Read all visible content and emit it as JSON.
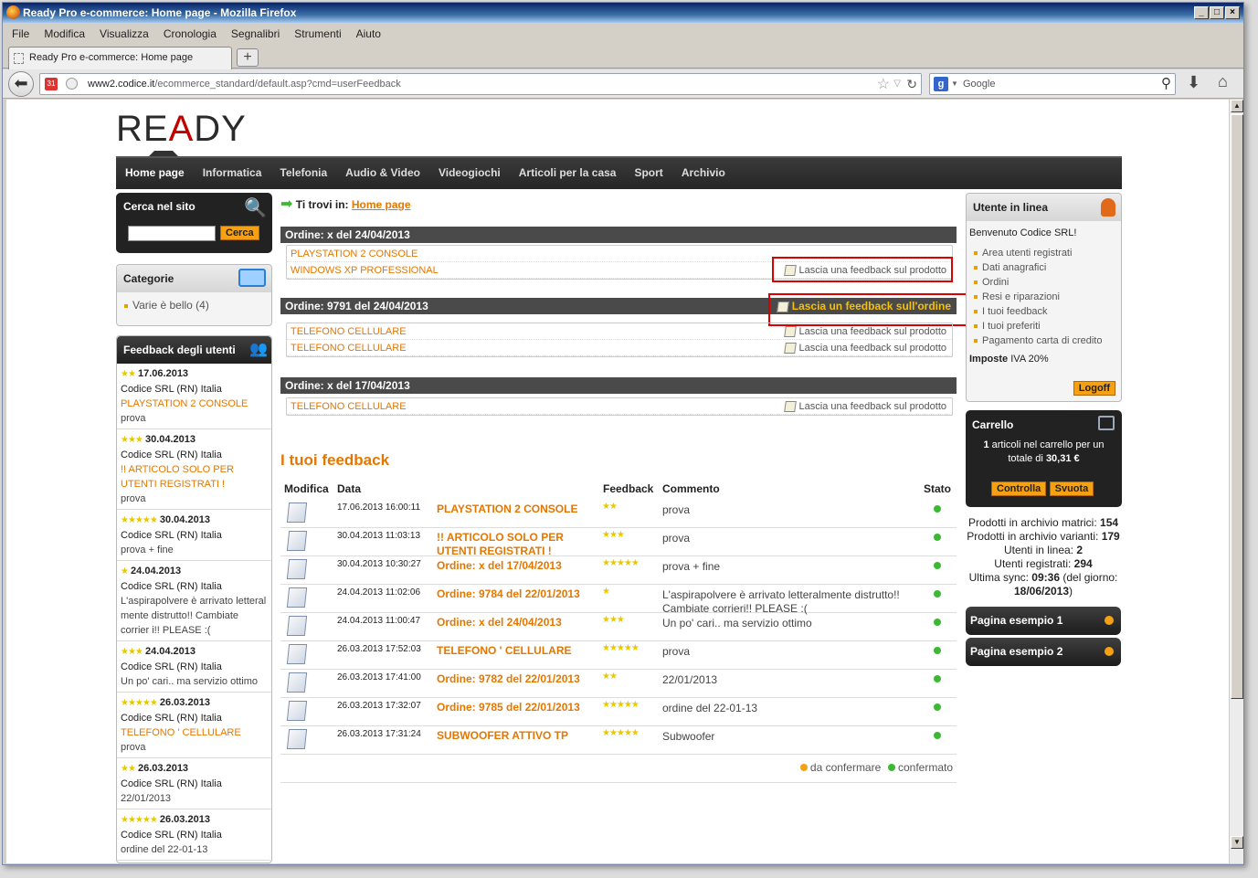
{
  "window": {
    "title": "Ready Pro e-commerce: Home page - Mozilla Firefox"
  },
  "menu": [
    "File",
    "Modifica",
    "Visualizza",
    "Cronologia",
    "Segnalibri",
    "Strumenti",
    "Aiuto"
  ],
  "tab": {
    "label": "Ready Pro e-commerce: Home page",
    "new_tab": "+"
  },
  "url": {
    "host": "www2.codice.it",
    "path": "/ecommerce_standard/default.asp?cmd=userFeedback"
  },
  "search": {
    "engine": "Google"
  },
  "site": {
    "logo": "READY",
    "nav": [
      "Home page",
      "Informatica",
      "Telefonia",
      "Audio & Video",
      "Videogiochi",
      "Articoli per la casa",
      "Sport",
      "Archivio"
    ],
    "breadcrumb": {
      "prefix": "Ti trovi in:",
      "link": "Home page"
    },
    "search_box": {
      "title": "Cerca nel sito",
      "button": "Cerca"
    },
    "categories": {
      "title": "Categorie",
      "items": [
        "Varie è bello (4)"
      ]
    },
    "feedback_box": {
      "title": "Feedback degli utenti",
      "items": [
        {
          "date": "17.06.2013",
          "user": "Codice SRL (RN) Italia",
          "product": "PLAYSTATION 2 CONSOLE",
          "comment": "prova",
          "stars": "★★"
        },
        {
          "date": "30.04.2013",
          "user": "Codice SRL (RN) Italia",
          "product": "!! ARTICOLO SOLO PER UTENTI REGISTRATI !",
          "comment": "prova",
          "stars": "★★★"
        },
        {
          "date": "30.04.2013",
          "user": "Codice SRL (RN) Italia",
          "product": "",
          "comment": "prova + fine",
          "stars": "★★★★★"
        },
        {
          "date": "24.04.2013",
          "user": "Codice SRL (RN) Italia",
          "product": "",
          "comment": "L'aspirapolvere è arrivato letteral mente distrutto!! Cambiate corrier i!! PLEASE :(",
          "stars": "★"
        },
        {
          "date": "24.04.2013",
          "user": "Codice SRL (RN) Italia",
          "product": "",
          "comment": "Un po' cari.. ma servizio ottimo",
          "stars": "★★★"
        },
        {
          "date": "26.03.2013",
          "user": "Codice SRL (RN) Italia",
          "product": "TELEFONO ' CELLULARE",
          "comment": "prova",
          "stars": "★★★★★"
        },
        {
          "date": "26.03.2013",
          "user": "Codice SRL (RN) Italia",
          "product": "",
          "comment": "22/01/2013",
          "stars": "★★"
        },
        {
          "date": "26.03.2013",
          "user": "Codice SRL (RN) Italia",
          "product": "",
          "comment": "ordine del 22-01-13",
          "stars": "★★★★★"
        }
      ]
    },
    "orders": [
      {
        "header": "Ordine: x del 24/04/2013",
        "rows": [
          {
            "name": "PLAYSTATION 2 CONSOLE",
            "action": ""
          },
          {
            "name": "WINDOWS XP PROFESSIONAL",
            "action": "Lascia una feedback sul prodotto"
          }
        ]
      },
      {
        "header": "Ordine: 9791 del 24/04/2013",
        "order_action": "Lascia un feedback sull'ordine",
        "rows": [
          {
            "name": "TELEFONO CELLULARE",
            "action": "Lascia una feedback sul prodotto"
          },
          {
            "name": "TELEFONO CELLULARE",
            "action": "Lascia una feedback sul prodotto"
          }
        ]
      },
      {
        "header": "Ordine: x del 17/04/2013",
        "rows": [
          {
            "name": "TELEFONO CELLULARE",
            "action": "Lascia una feedback sul prodotto"
          }
        ]
      }
    ],
    "your_feedback": {
      "title": "I tuoi feedback",
      "columns": {
        "edit": "Modifica",
        "date": "Data",
        "feedback": "Feedback",
        "comment": "Commento",
        "status": "Stato"
      },
      "rows": [
        {
          "date": "17.06.2013 16:00:11",
          "item": "PLAYSTATION 2 CONSOLE",
          "stars": "★★",
          "comment": "prova"
        },
        {
          "date": "30.04.2013 11:03:13",
          "item": "!! ARTICOLO SOLO PER UTENTI REGISTRATI !",
          "stars": "★★★",
          "comment": "prova"
        },
        {
          "date": "30.04.2013 10:30:27",
          "item": "Ordine: x del 17/04/2013",
          "stars": "★★★★★",
          "comment": "prova + fine"
        },
        {
          "date": "24.04.2013 11:02:06",
          "item": "Ordine: 9784 del 22/01/2013",
          "stars": "★",
          "comment": "L'aspirapolvere è arrivato letteralmente distrutto!! Cambiate corrieri!! PLEASE :("
        },
        {
          "date": "24.04.2013 11:00:47",
          "item": "Ordine: x del 24/04/2013",
          "stars": "★★★",
          "comment": "Un po' cari.. ma servizio ottimo"
        },
        {
          "date": "26.03.2013 17:52:03",
          "item": "TELEFONO ' CELLULARE",
          "stars": "★★★★★",
          "comment": "prova"
        },
        {
          "date": "26.03.2013 17:41:00",
          "item": "Ordine: 9782 del 22/01/2013",
          "stars": "★★",
          "comment": "22/01/2013"
        },
        {
          "date": "26.03.2013 17:32:07",
          "item": "Ordine: 9785 del 22/01/2013",
          "stars": "★★★★★",
          "comment": "ordine del 22-01-13"
        },
        {
          "date": "26.03.2013 17:31:24",
          "item": "SUBWOOFER ATTIVO TP",
          "stars": "★★★★★",
          "comment": "Subwoofer"
        }
      ],
      "legend": {
        "pending": "da confermare",
        "confirmed": "confermato"
      }
    },
    "user_box": {
      "title": "Utente in linea",
      "welcome": "Benvenuto Codice SRL!",
      "links": [
        "Area utenti registrati",
        "Dati anagrafici",
        "Ordini",
        "Resi e riparazioni",
        "I tuoi feedback",
        "I tuoi preferiti",
        "Pagamento carta di credito"
      ],
      "tax_label": "Imposte",
      "tax_value": "IVA 20%",
      "logoff": "Logoff"
    },
    "cart": {
      "title": "Carrello",
      "count": "1",
      "text1": "articoli nel carrello per un totale di",
      "total": "30,31 €",
      "check": "Controlla",
      "empty": "Svuota"
    },
    "stats": [
      {
        "label": "Prodotti in archivio matrici:",
        "value": "154"
      },
      {
        "label": "Prodotti in archivio varianti:",
        "value": "179"
      },
      {
        "label": "Utenti in linea:",
        "value": "2"
      },
      {
        "label": "Utenti registrati:",
        "value": "294"
      },
      {
        "label": "Ultima sync:",
        "value": "09:36",
        "suffix": "(del giorno:",
        "date": "18/06/2013",
        "close": ")"
      }
    ],
    "pages": [
      "Pagina esempio 1",
      "Pagina esempio 2"
    ]
  }
}
